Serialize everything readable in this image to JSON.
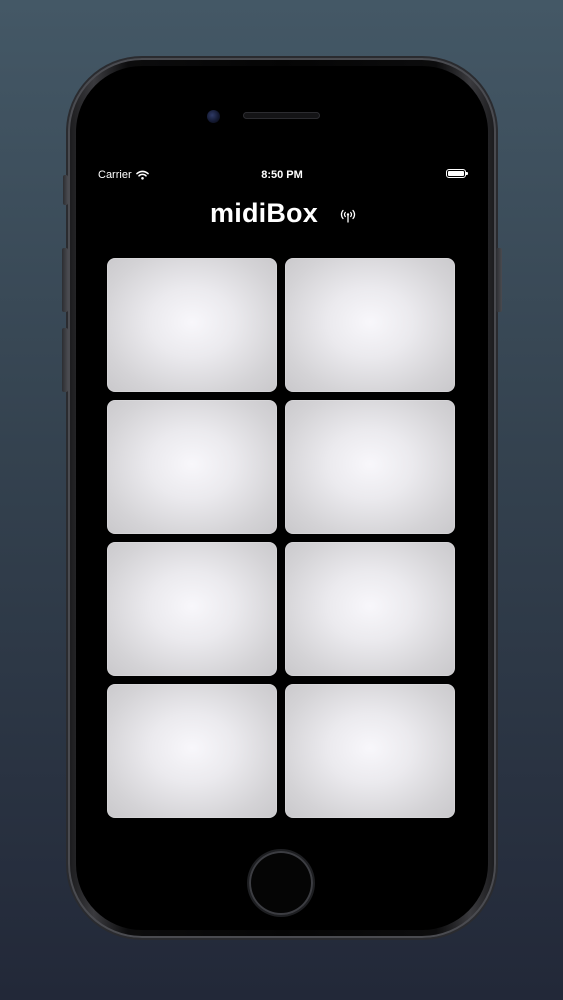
{
  "status_bar": {
    "carrier": "Carrier",
    "time": "8:50 PM",
    "wifi_icon": "wifi-icon",
    "battery_icon": "battery-icon"
  },
  "app": {
    "title": "midiBox",
    "connection_icon": "antenna-icon"
  },
  "pads": [
    {
      "id": "pad-1"
    },
    {
      "id": "pad-2"
    },
    {
      "id": "pad-3"
    },
    {
      "id": "pad-4"
    },
    {
      "id": "pad-5"
    },
    {
      "id": "pad-6"
    },
    {
      "id": "pad-7"
    },
    {
      "id": "pad-8"
    }
  ],
  "colors": {
    "background_top": "#445866",
    "background_bottom": "#222838",
    "screen": "#000000",
    "pad_center": "#f8f7fb",
    "pad_edge": "#c9c8cb",
    "text": "#ffffff"
  }
}
